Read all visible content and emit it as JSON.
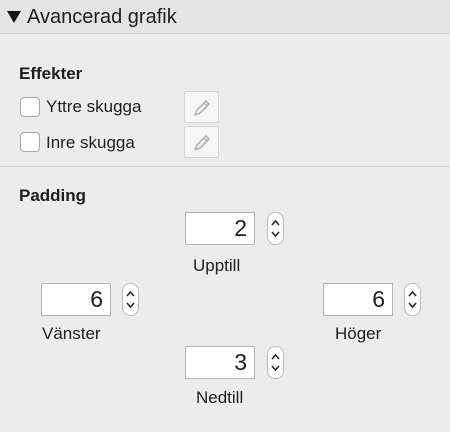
{
  "header": {
    "title": "Avancerad grafik",
    "disclosure_icon": "triangle-down-icon"
  },
  "effects": {
    "title": "Effekter",
    "outer_shadow": {
      "label": "Yttre skugga",
      "checked": false
    },
    "inner_shadow": {
      "label": "Inre skugga",
      "checked": false
    },
    "edit_icon": "pencil-icon"
  },
  "padding": {
    "title": "Padding",
    "top": {
      "value": "2",
      "label": "Upptill"
    },
    "left": {
      "value": "6",
      "label": "Vänster"
    },
    "right": {
      "value": "6",
      "label": "Höger"
    },
    "bottom": {
      "value": "3",
      "label": "Nedtill"
    }
  }
}
